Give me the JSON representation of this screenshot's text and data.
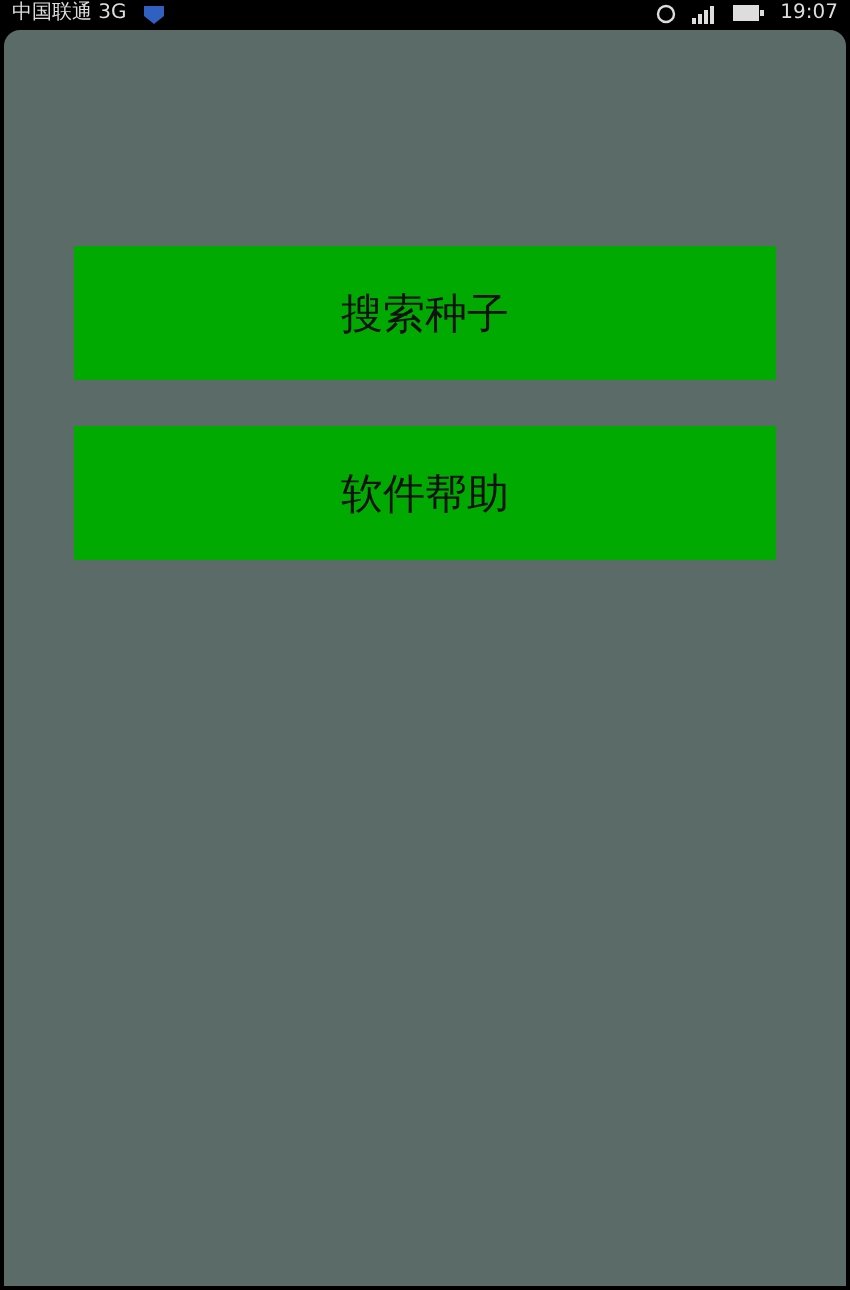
{
  "status_bar": {
    "carrier": "中国联通 3G",
    "time": "19:07"
  },
  "buttons": [
    {
      "label": "搜索种子"
    },
    {
      "label": "软件帮助"
    }
  ]
}
